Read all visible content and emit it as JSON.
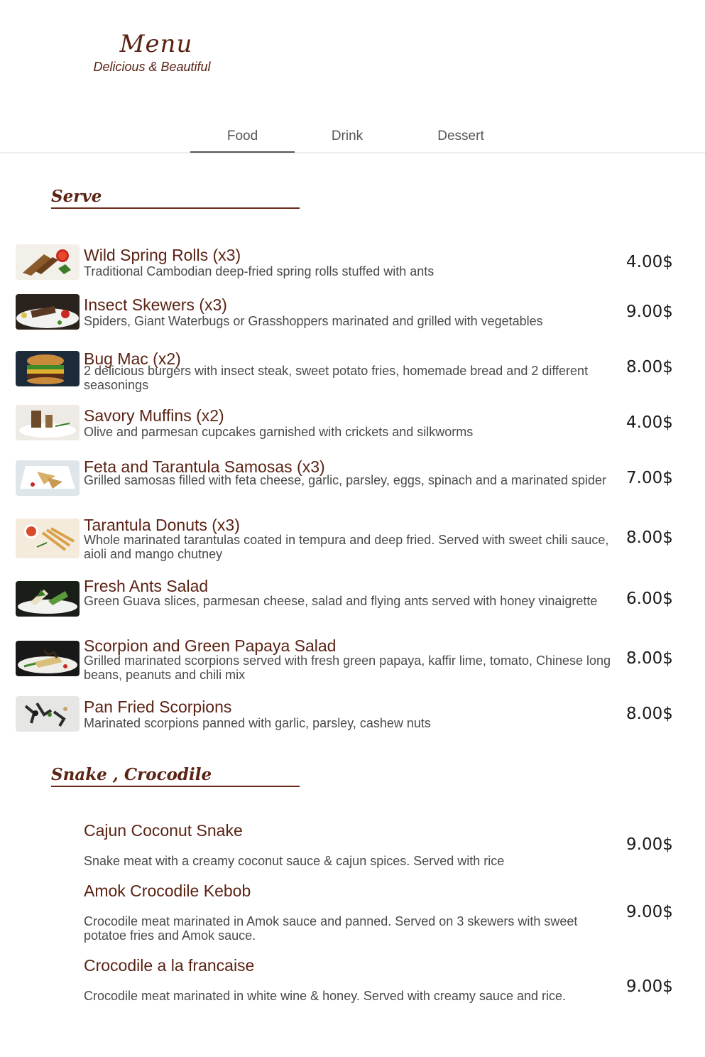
{
  "brand": {
    "title": "Menu",
    "subtitle": "Delicious & Beautiful"
  },
  "tabs": [
    {
      "label": "Food",
      "active": true
    },
    {
      "label": "Drink",
      "active": false
    },
    {
      "label": "Dessert",
      "active": false
    }
  ],
  "sections": [
    {
      "title": "Serve",
      "items": [
        {
          "name": "Wild Spring Rolls (x3)",
          "description": "Traditional Cambodian deep-fried spring rolls stuffed with ants",
          "price": "4.00$"
        },
        {
          "name": "Insect Skewers (x3)",
          "description": "Spiders, Giant Waterbugs or Grasshoppers marinated and grilled with vegetables",
          "price": "9.00$"
        },
        {
          "name": "Bug Mac (x2)",
          "description": "2 delicious burgers with insect steak, sweet potato fries, homemade bread and 2 different seasonings",
          "price": "8.00$"
        },
        {
          "name": "Savory Muffins (x2)",
          "description": "Olive and parmesan cupcakes garnished with crickets and silkworms",
          "price": "4.00$"
        },
        {
          "name": "Feta and Tarantula Samosas (x3)",
          "description": "Grilled samosas filled with feta cheese, garlic, parsley, eggs, spinach and a marinated spider",
          "price": "7.00$"
        },
        {
          "name": "Tarantula Donuts (x3)",
          "description": "Whole marinated tarantulas coated in tempura and deep fried. Served with sweet chili sauce, aioli and mango chutney",
          "price": "8.00$"
        },
        {
          "name": "Fresh Ants Salad",
          "description": "Green Guava slices, parmesan cheese, salad and flying ants served with honey vinaigrette",
          "price": "6.00$"
        },
        {
          "name": "Scorpion and Green Papaya Salad",
          "description": "Grilled marinated scorpions served with fresh green papaya, kaffir lime, tomato, Chinese long beans, peanuts and chili mix",
          "price": "8.00$"
        },
        {
          "name": "Pan Fried Scorpions",
          "description": "Marinated scorpions panned with garlic, parsley, cashew nuts",
          "price": "8.00$"
        }
      ]
    },
    {
      "title": "Snake , Crocodile",
      "items": [
        {
          "name": "Cajun Coconut Snake",
          "description": "Snake meat with a creamy coconut sauce & cajun spices. Served with rice",
          "price": "9.00$"
        },
        {
          "name": "Amok Crocodile Kebob",
          "description": "Crocodile meat marinated in Amok sauce and panned. Served on 3 skewers with sweet potatoe fries and Amok sauce.",
          "price": "9.00$"
        },
        {
          "name": "Crocodile a la francaise",
          "description": "Crocodile meat marinated in white wine & honey. Served with creamy sauce and rice.",
          "price": "9.00$"
        }
      ]
    }
  ]
}
